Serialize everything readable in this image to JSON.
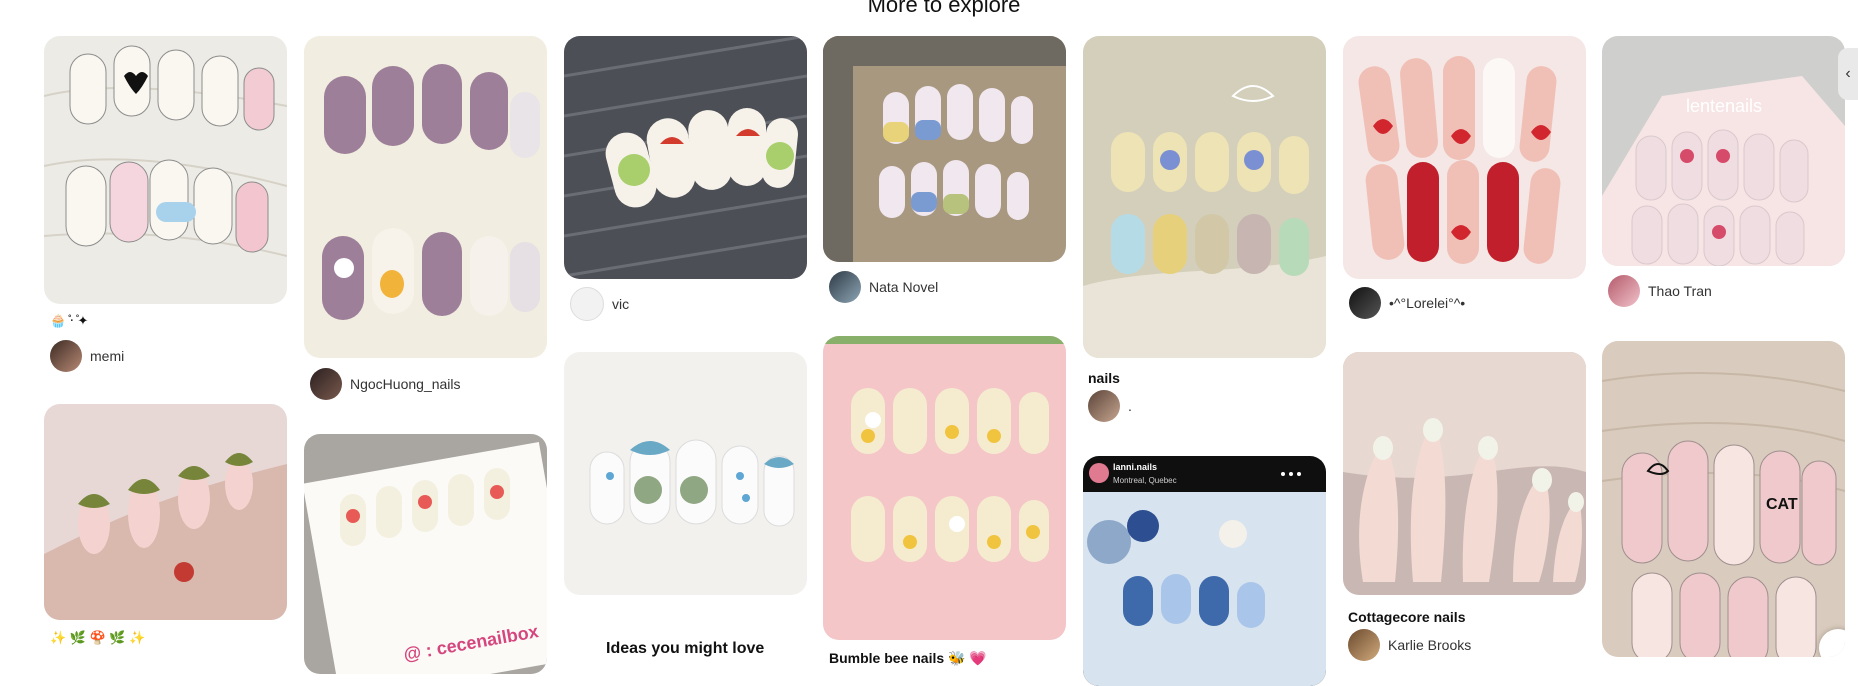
{
  "heading": "More to explore",
  "pins": [
    {
      "id": "p1",
      "creator": "memi",
      "caption": "🧁 ̊‧ ̊✦"
    },
    {
      "id": "p2",
      "creator": "NgocHuong_nails"
    },
    {
      "id": "p3",
      "creator": "vic"
    },
    {
      "id": "p4",
      "creator": "Nata Novel"
    },
    {
      "id": "p5",
      "title": "nails",
      "creator": "."
    },
    {
      "id": "p6",
      "creator": "•^°Lorelei°^•"
    },
    {
      "id": "p7",
      "creator": "Thao Tran"
    },
    {
      "id": "p8",
      "caption": "✨ 🌿 🍄 🌿 ✨"
    },
    {
      "id": "p11",
      "title": "Cottagecore nails",
      "creator": "Karlie Brooks"
    }
  ],
  "ideas_label": "Ideas you might love",
  "pin_overlay_text": {
    "p9_brand": "@ : cecenailbox",
    "p10_partial": "Bumble bee nails 🐝 💗",
    "p12_account": "lanni.nails",
    "p12_location": "Montreal, Quebec",
    "p7_watermark": "lentenails"
  },
  "icons": {
    "side_handle": "chevron-left-icon"
  },
  "colors": {
    "background": "#ffffff",
    "text": "#111111"
  }
}
